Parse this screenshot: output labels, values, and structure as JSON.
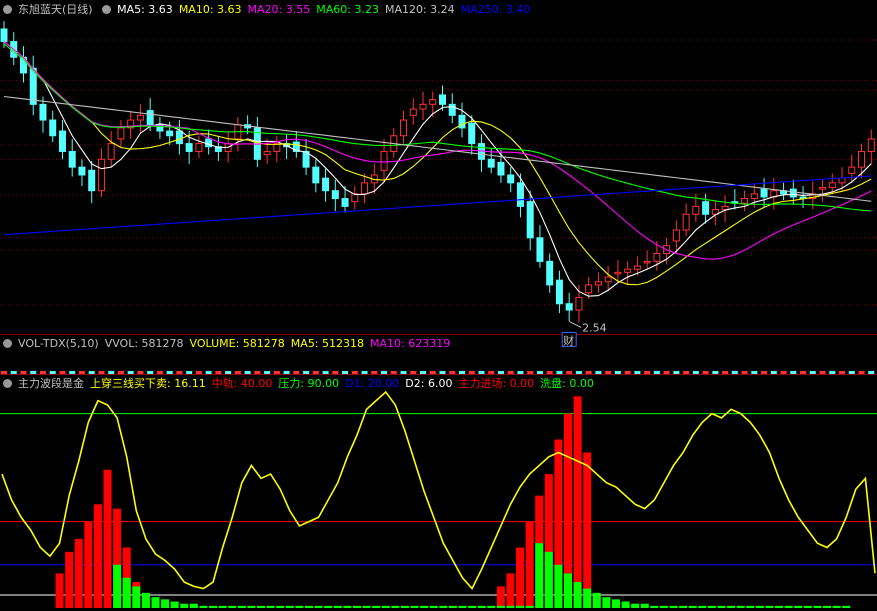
{
  "main_header": {
    "title": "东旭蓝天",
    "period": "(日线)",
    "ma": [
      {
        "label": "MA5: 3.63",
        "color": "#ffffff"
      },
      {
        "label": "MA10: 3.63",
        "color": "#ffff00"
      },
      {
        "label": "MA20: 3.55",
        "color": "#ff00ff"
      },
      {
        "label": "MA60: 3.23",
        "color": "#00ff00"
      },
      {
        "label": "MA120: 3.24",
        "color": "#c0c0c0"
      },
      {
        "label": "MA250: 3.40",
        "color": "#0000ff"
      }
    ]
  },
  "vol_header": {
    "name": "VOL-TDX(5,10)",
    "items": [
      {
        "label": "VVOL: 581278",
        "color": "#c0c0c0"
      },
      {
        "label": "VOLUME: 581278",
        "color": "#ffff00"
      },
      {
        "label": "MA5: 512318",
        "color": "#ffff00"
      },
      {
        "label": "MA10: 623319",
        "color": "#ff00ff"
      }
    ]
  },
  "ind_header": {
    "name": "主力波段是金",
    "items": [
      {
        "label": "上穿三线买下卖: 16.11",
        "color": "#ffff00"
      },
      {
        "label": "中轨: 40.00",
        "color": "#ff0000"
      },
      {
        "label": "压力: 90.00",
        "color": "#00ff00"
      },
      {
        "label": "D1: 20.00",
        "color": "#0000ff"
      },
      {
        "label": "D2: 6.00",
        "color": "#ffffff"
      },
      {
        "label": "主力进场: 0.00",
        "color": "#ff0000"
      },
      {
        "label": "洗盘: 0.00",
        "color": "#00ff00"
      }
    ]
  },
  "low_marker": {
    "label": "2.54",
    "tag": "财"
  },
  "colors": {
    "up": "#ff3232",
    "down": "#54ffff",
    "grid": "#8b0000",
    "ma5": "#ffffff",
    "ma10": "#ffff00",
    "ma20": "#ff00ff",
    "ma60": "#00ff00",
    "ma120": "#c0c0c0",
    "ma250": "#0000ff"
  },
  "chart_data": [
    {
      "type": "line",
      "title": "东旭蓝天 (日线)",
      "note": "approximate candlestick closes (daily, price in CNY); moving averages",
      "ylim": [
        2.4,
        4.4
      ],
      "closes": [
        4.25,
        4.15,
        4.05,
        3.85,
        3.75,
        3.65,
        3.55,
        3.45,
        3.4,
        3.3,
        3.5,
        3.6,
        3.7,
        3.75,
        3.78,
        3.72,
        3.68,
        3.65,
        3.6,
        3.55,
        3.6,
        3.58,
        3.55,
        3.6,
        3.72,
        3.7,
        3.5,
        3.55,
        3.6,
        3.58,
        3.55,
        3.45,
        3.35,
        3.3,
        3.25,
        3.2,
        3.28,
        3.35,
        3.4,
        3.55,
        3.65,
        3.75,
        3.82,
        3.85,
        3.88,
        3.85,
        3.78,
        3.7,
        3.6,
        3.5,
        3.45,
        3.4,
        3.35,
        3.2,
        3.0,
        2.85,
        2.7,
        2.58,
        2.54,
        2.62,
        2.7,
        2.72,
        2.75,
        2.78,
        2.8,
        2.82,
        2.85,
        2.9,
        2.95,
        3.05,
        3.15,
        3.2,
        3.15,
        3.18,
        3.2,
        3.22,
        3.25,
        3.28,
        3.26,
        3.3,
        3.28,
        3.26,
        3.25,
        3.28,
        3.32,
        3.35,
        3.38,
        3.45,
        3.55,
        3.63
      ],
      "series": [
        {
          "name": "MA5",
          "last": 3.63
        },
        {
          "name": "MA10",
          "last": 3.63
        },
        {
          "name": "MA20",
          "last": 3.55
        },
        {
          "name": "MA60",
          "last": 3.23
        },
        {
          "name": "MA120",
          "last": 3.24
        },
        {
          "name": "MA250",
          "last": 3.4
        }
      ],
      "annotations": [
        "2.54"
      ]
    },
    {
      "type": "line",
      "title": "主力波段是金",
      "ylim": [
        0,
        100
      ],
      "reference_lines": {
        "压力": 90,
        "中轨": 40,
        "D1": 20,
        "D2": 6
      },
      "series": [
        {
          "name": "上穿三线买下卖",
          "values": [
            62,
            50,
            42,
            36,
            28,
            24,
            30,
            52,
            68,
            86,
            96,
            94,
            88,
            70,
            45,
            32,
            25,
            22,
            18,
            12,
            10,
            9,
            12,
            28,
            42,
            58,
            66,
            60,
            62,
            55,
            45,
            38,
            40,
            42,
            50,
            58,
            70,
            80,
            92,
            96,
            100,
            94,
            82,
            68,
            54,
            42,
            30,
            22,
            14,
            9,
            18,
            28,
            38,
            48,
            56,
            62,
            66,
            70,
            72,
            70,
            68,
            66,
            62,
            58,
            56,
            52,
            48,
            46,
            50,
            58,
            66,
            72,
            80,
            86,
            90,
            88,
            92,
            90,
            86,
            80,
            72,
            60,
            50,
            42,
            36,
            30,
            28,
            32,
            42,
            55,
            60,
            16.11
          ]
        },
        {
          "name": "主力进场",
          "values": [
            0,
            0,
            0,
            0,
            0,
            0,
            16,
            26,
            32,
            40,
            48,
            64,
            46,
            28,
            12,
            0,
            0,
            0,
            0,
            0,
            0,
            0,
            0,
            0,
            0,
            0,
            0,
            0,
            0,
            0,
            0,
            0,
            0,
            0,
            0,
            0,
            0,
            0,
            0,
            0,
            0,
            0,
            0,
            0,
            0,
            0,
            0,
            0,
            0,
            0,
            0,
            0,
            10,
            16,
            28,
            40,
            52,
            62,
            78,
            90,
            98,
            72,
            0,
            0,
            0,
            0,
            0,
            0,
            0,
            0,
            0,
            0,
            0,
            0,
            0,
            0,
            0,
            0,
            0,
            0,
            0,
            0,
            0,
            0,
            0,
            0,
            0,
            0,
            0,
            0,
            0,
            0
          ]
        },
        {
          "name": "洗盘",
          "values": [
            0,
            0,
            0,
            0,
            0,
            0,
            0,
            0,
            0,
            0,
            0,
            0,
            20,
            14,
            10,
            7,
            5,
            4,
            3,
            2,
            2,
            1,
            1,
            1,
            1,
            1,
            1,
            1,
            1,
            1,
            1,
            1,
            1,
            1,
            1,
            1,
            1,
            1,
            1,
            1,
            1,
            1,
            1,
            1,
            1,
            1,
            1,
            1,
            1,
            1,
            1,
            1,
            1,
            1,
            1,
            1,
            30,
            26,
            20,
            16,
            12,
            9,
            7,
            5,
            4,
            3,
            2,
            2,
            1,
            1,
            1,
            1,
            1,
            1,
            1,
            1,
            1,
            1,
            1,
            1,
            1,
            1,
            1,
            1,
            1,
            1,
            1,
            1,
            1,
            0,
            0,
            0
          ]
        }
      ],
      "last": {
        "上穿三线买下卖": 16.11,
        "中轨": 40.0,
        "压力": 90.0,
        "D1": 20.0,
        "D2": 6.0,
        "主力进场": 0.0,
        "洗盘": 0.0
      }
    }
  ]
}
